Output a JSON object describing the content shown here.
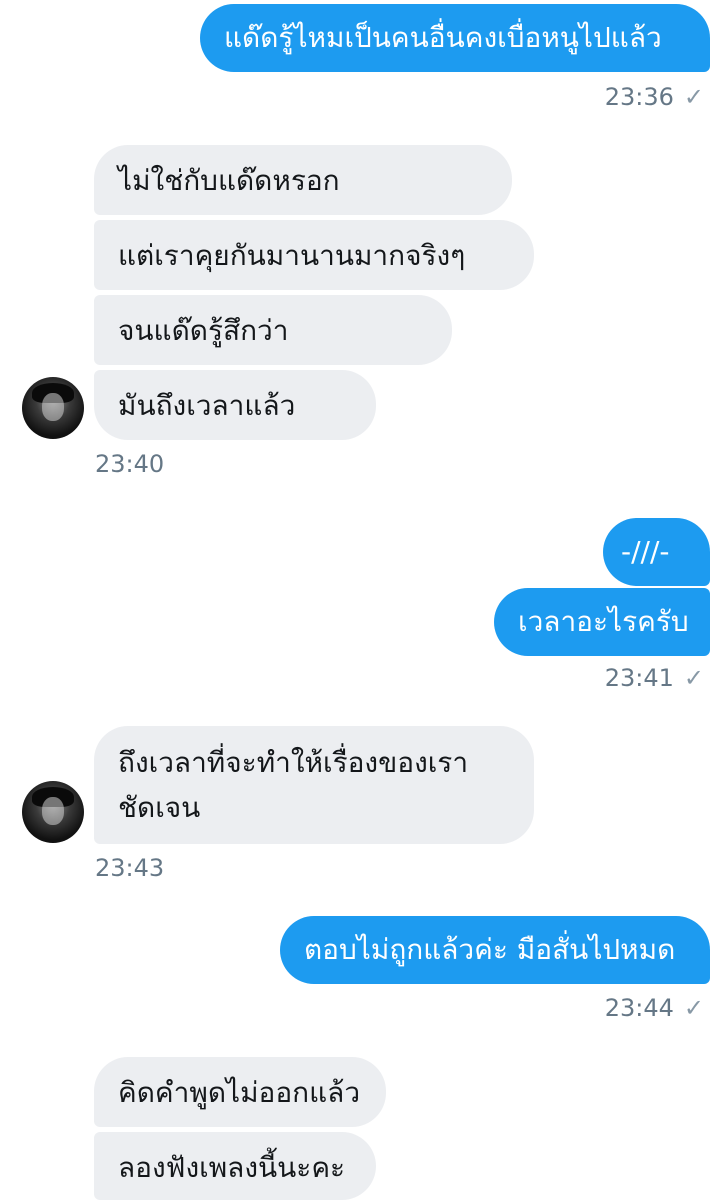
{
  "conversation": {
    "messages": [
      {
        "from": "me",
        "text": "แด๊ดรู้ไหมเป็นคนอื่นคงเบื่อหนูไปแล้ว"
      },
      {
        "from": "them",
        "text": "ไม่ใช่กับแด๊ดหรอก"
      },
      {
        "from": "them",
        "text": "แต่เราคุยกันมานานมากจริงๆ"
      },
      {
        "from": "them",
        "text": "จนแด๊ดรู้สึกว่า"
      },
      {
        "from": "them",
        "text": "มันถึงเวลาแล้ว"
      },
      {
        "from": "me",
        "text": "-///-"
      },
      {
        "from": "me",
        "text": "เวลาอะไรครับ"
      },
      {
        "from": "them",
        "text": "ถึงเวลาที่จะทำให้เรื่องของเรา ชัดเจน"
      },
      {
        "from": "me",
        "text": "ตอบไม่ถูกแล้วค่ะ มือสั่นไปหมด"
      },
      {
        "from": "them",
        "text": "คิดคำพูดไม่ออกแล้ว"
      },
      {
        "from": "them",
        "text": "ลองฟังเพลงนี้นะคะ"
      }
    ],
    "timestamps": [
      "23:36",
      "23:40",
      "23:41",
      "23:43",
      "23:44"
    ],
    "sent_check": "✓",
    "colors": {
      "outgoing": "#1d9bf0",
      "incoming": "#eceef1",
      "time": "#657786"
    }
  }
}
